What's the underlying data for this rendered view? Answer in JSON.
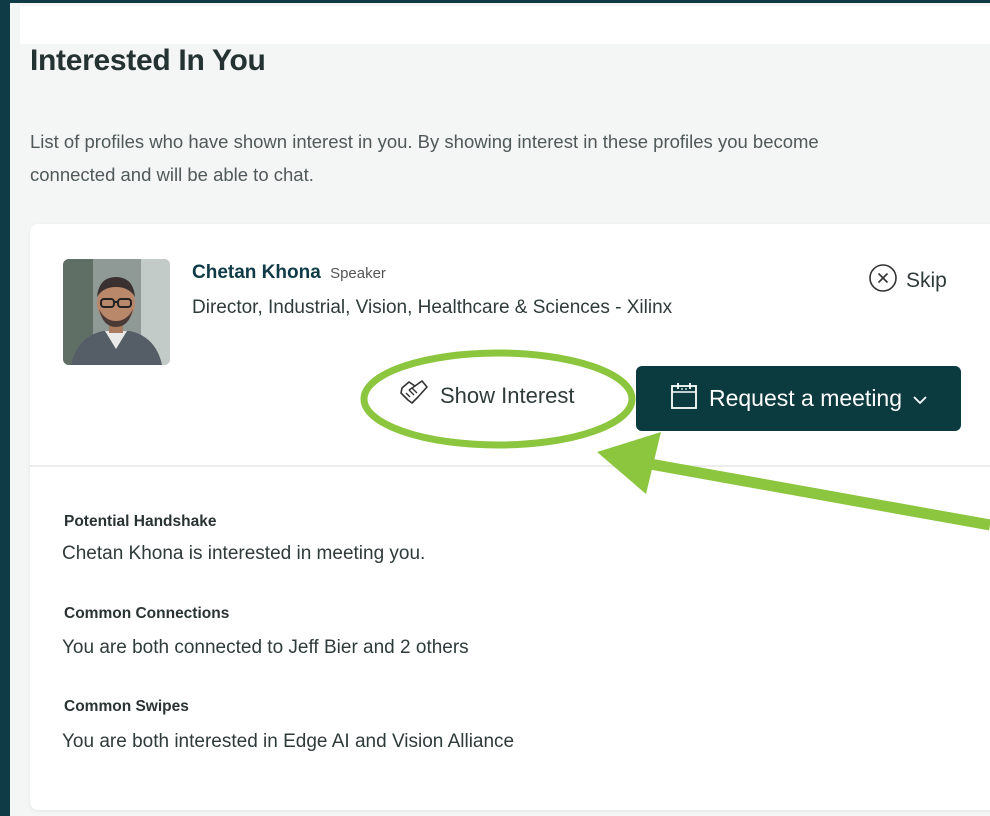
{
  "page": {
    "title": "Interested In You",
    "description_line1": "List of profiles who have shown interest in you. By showing interest in these profiles you become",
    "description_line2": "connected and will be able to chat."
  },
  "profile": {
    "name": "Chetan Khona",
    "role": "Speaker",
    "title": "Director, Industrial, Vision, Healthcare & Sciences - Xilinx"
  },
  "actions": {
    "skip_label": "Skip",
    "show_interest_label": "Show Interest",
    "request_meeting_label": "Request a meeting"
  },
  "details": [
    {
      "label": "Potential Handshake",
      "text": "Chetan Khona is interested in meeting you."
    },
    {
      "label": "Common Connections",
      "text": "You are both connected to Jeff Bier and 2 others"
    },
    {
      "label": "Common Swipes",
      "text": "You are both interested in Edge AI and Vision Alliance"
    }
  ],
  "colors": {
    "primary": "#0b3a3f",
    "frame": "#0e3b46",
    "annotation": "#8cc63f"
  },
  "icons": [
    "close-circle-icon",
    "handshake-icon",
    "calendar-icon",
    "chevron-down-icon"
  ]
}
